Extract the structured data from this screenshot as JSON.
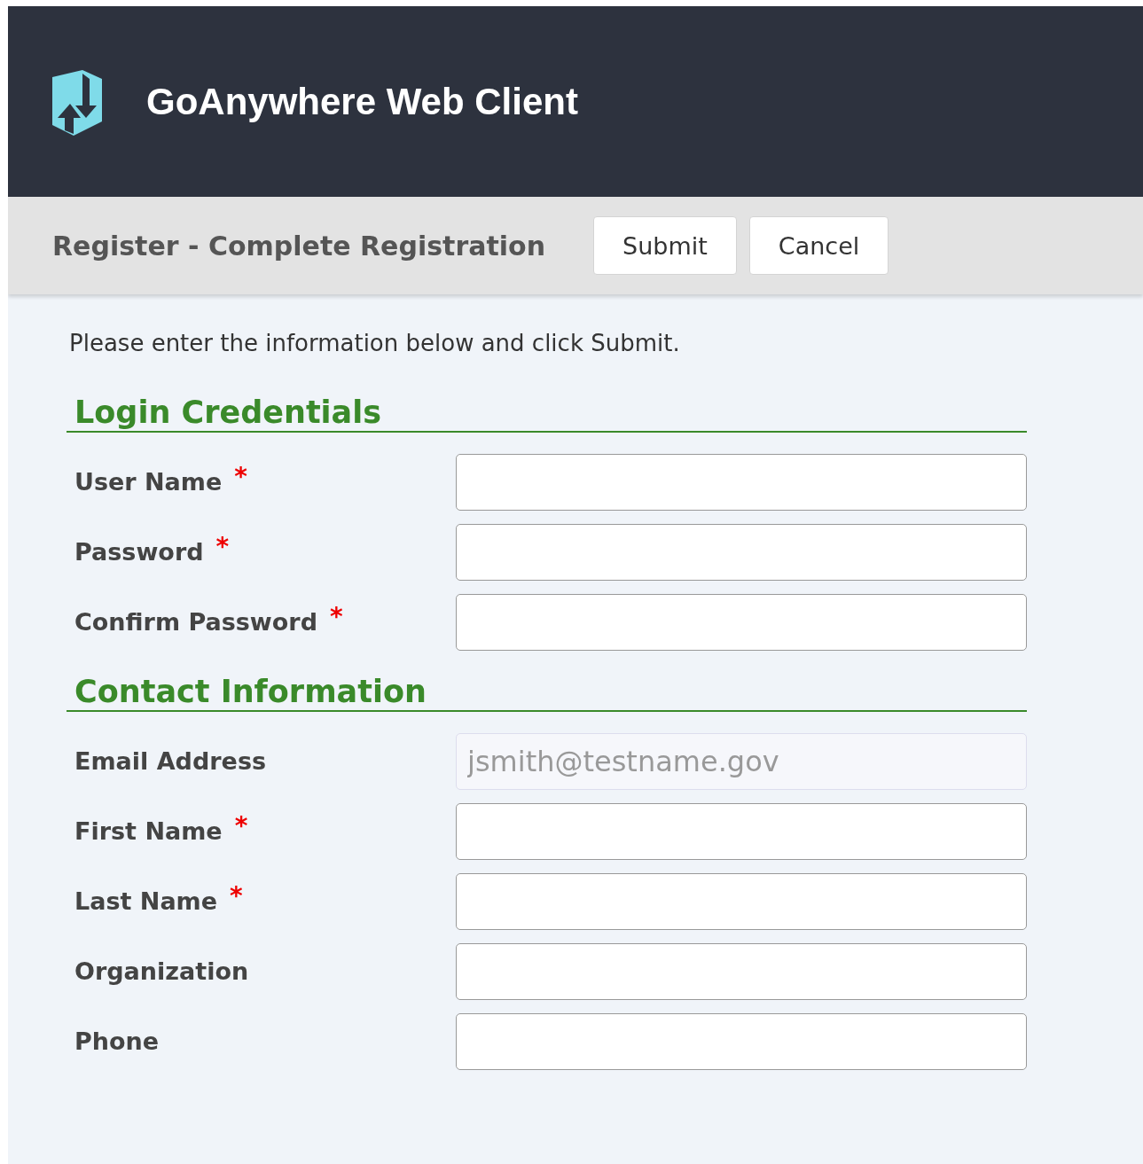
{
  "header": {
    "title": "GoAnywhere Web Client"
  },
  "toolbar": {
    "title": "Register - Complete Registration",
    "buttons": [
      "Submit",
      "Cancel"
    ]
  },
  "intro": "Please enter the information below and click Submit.",
  "sections": [
    {
      "title": "Login Credentials",
      "fields": [
        {
          "label": "User Name",
          "required": true,
          "disabled": false
        },
        {
          "label": "Password",
          "required": true,
          "disabled": false
        },
        {
          "label": "Confirm Password",
          "required": true,
          "disabled": false
        }
      ]
    },
    {
      "title": "Contact Information",
      "fields": [
        {
          "label": "Email Address",
          "required": false,
          "disabled": true,
          "value": "jsmith@testname.gov"
        },
        {
          "label": "First Name",
          "required": true,
          "disabled": false
        },
        {
          "label": "Last Name",
          "required": true,
          "disabled": false
        },
        {
          "label": "Organization",
          "required": false,
          "disabled": false
        },
        {
          "label": "Phone",
          "required": false,
          "disabled": false
        }
      ]
    }
  ],
  "required_mark": "*"
}
